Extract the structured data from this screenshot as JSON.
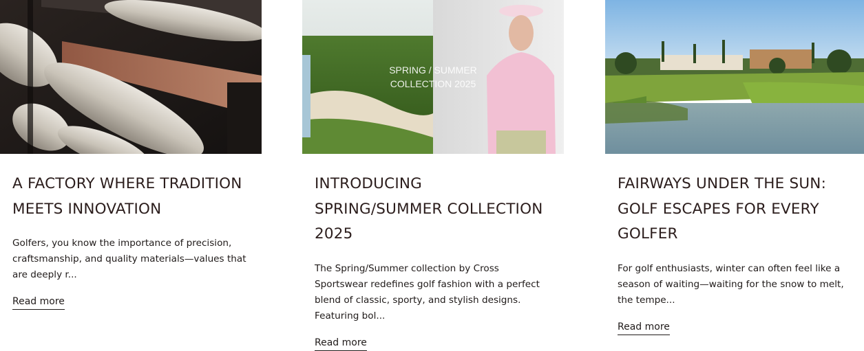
{
  "posts": [
    {
      "image_subject": "factory-yarn-spools",
      "title": "A FACTORY WHERE TRADITION MEETS INNOVATION",
      "excerpt": "Golfers, you know the importance of precision, craftsmanship, and quality materials—values that are deeply r...",
      "link": "Read more"
    },
    {
      "image_subject": "spring-summer-golf-collection",
      "image_overlay_line1": "SPRING / SUMMER",
      "image_overlay_line2": "COLLECTION 2025",
      "title": "INTRODUCING SPRING/SUMMER COLLECTION 2025",
      "excerpt": "The Spring/Summer collection by Cross Sportswear redefines golf fashion with a perfect blend of classic, sporty, and stylish designs. Featuring bol...",
      "link": "Read more"
    },
    {
      "image_subject": "golf-course-lake-resort",
      "title": "FAIRWAYS UNDER THE SUN: GOLF ESCAPES FOR EVERY GOLFER",
      "excerpt": "For golf enthusiasts, winter can often feel like a season of waiting—waiting for the snow to melt, the tempe...",
      "link": "Read more"
    }
  ]
}
